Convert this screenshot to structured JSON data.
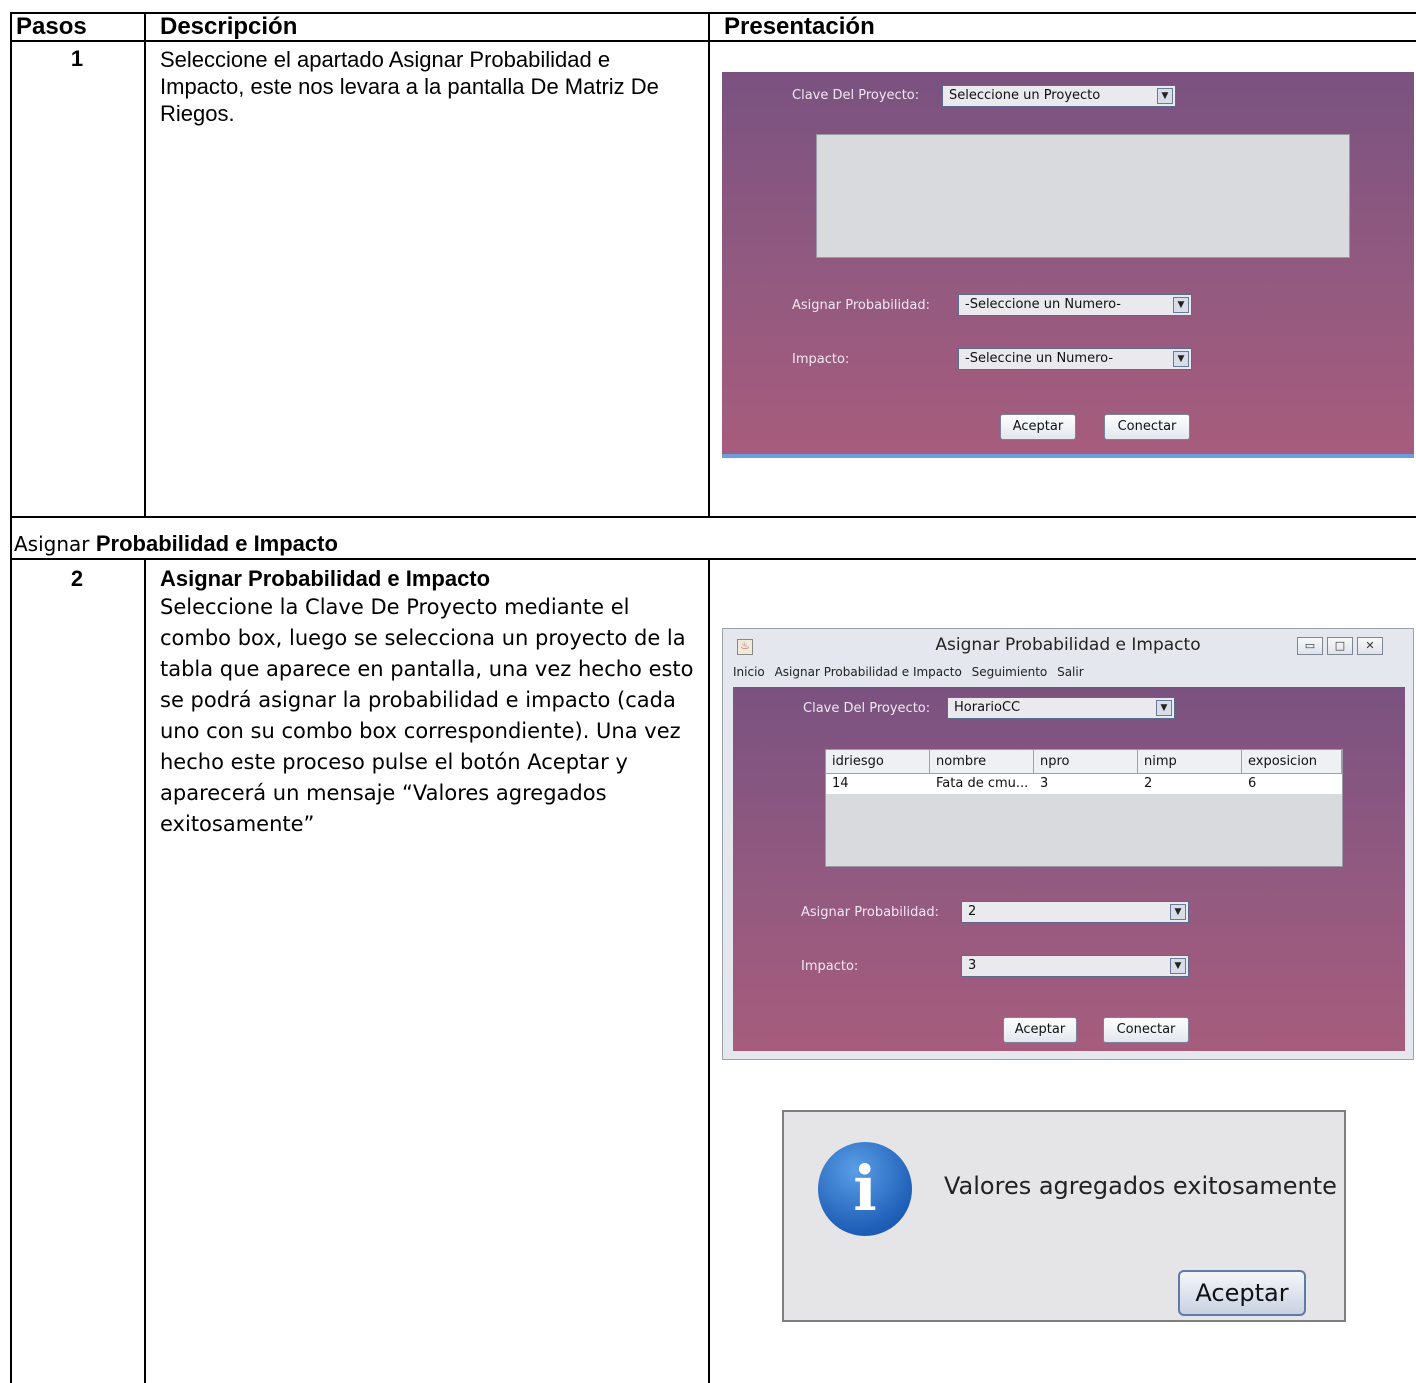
{
  "header": {
    "steps": "Pasos",
    "description": "Descripción",
    "presentation": "Presentación"
  },
  "step1": {
    "number": "1",
    "description": "Seleccione el apartado Asignar Probabilidad e Impacto, este nos levara a la pantalla De Matriz De Riegos.",
    "form": {
      "project_label": "Clave Del Proyecto:",
      "project_value": "Seleccione un Proyecto",
      "prob_label": "Asignar Probabilidad:",
      "prob_value": "-Seleccione un Numero-",
      "impact_label": "Impacto:",
      "impact_value": "-Seleccine un Numero-",
      "accept": "Aceptar",
      "connect": "Conectar"
    }
  },
  "section": {
    "light": "Asignar ",
    "bold": "Probabilidad e Impacto"
  },
  "step2": {
    "number": "2",
    "title": "Asignar Probabilidad e Impacto",
    "description": "Seleccione la Clave De Proyecto mediante el combo box, luego se selecciona un proyecto de la tabla que aparece en pantalla, una vez hecho esto se podrá asignar la probabilidad e impacto (cada uno con su combo box correspondiente). Una vez hecho este proceso pulse el botón Aceptar y aparecerá un mensaje “Valores agregados exitosamente”",
    "window": {
      "title": "Asignar Probabilidad e Impacto",
      "menu": [
        "Inicio",
        "Asignar Probabilidad e Impacto",
        "Seguimiento",
        "Salir"
      ],
      "project_label": "Clave Del Proyecto:",
      "project_value": "HorarioCC",
      "columns": [
        "idriesgo",
        "nombre",
        "npro",
        "nimp",
        "exposicion"
      ],
      "row": [
        "14",
        "Fata de cmu...",
        "3",
        "2",
        "6"
      ],
      "prob_label": "Asignar Probabilidad:",
      "prob_value": "2",
      "impact_label": "Impacto:",
      "impact_value": "3",
      "accept": "Aceptar",
      "connect": "Conectar"
    },
    "dialog": {
      "message": "Valores agregados exitosamente",
      "button": "Aceptar",
      "icon": "info-icon"
    }
  }
}
